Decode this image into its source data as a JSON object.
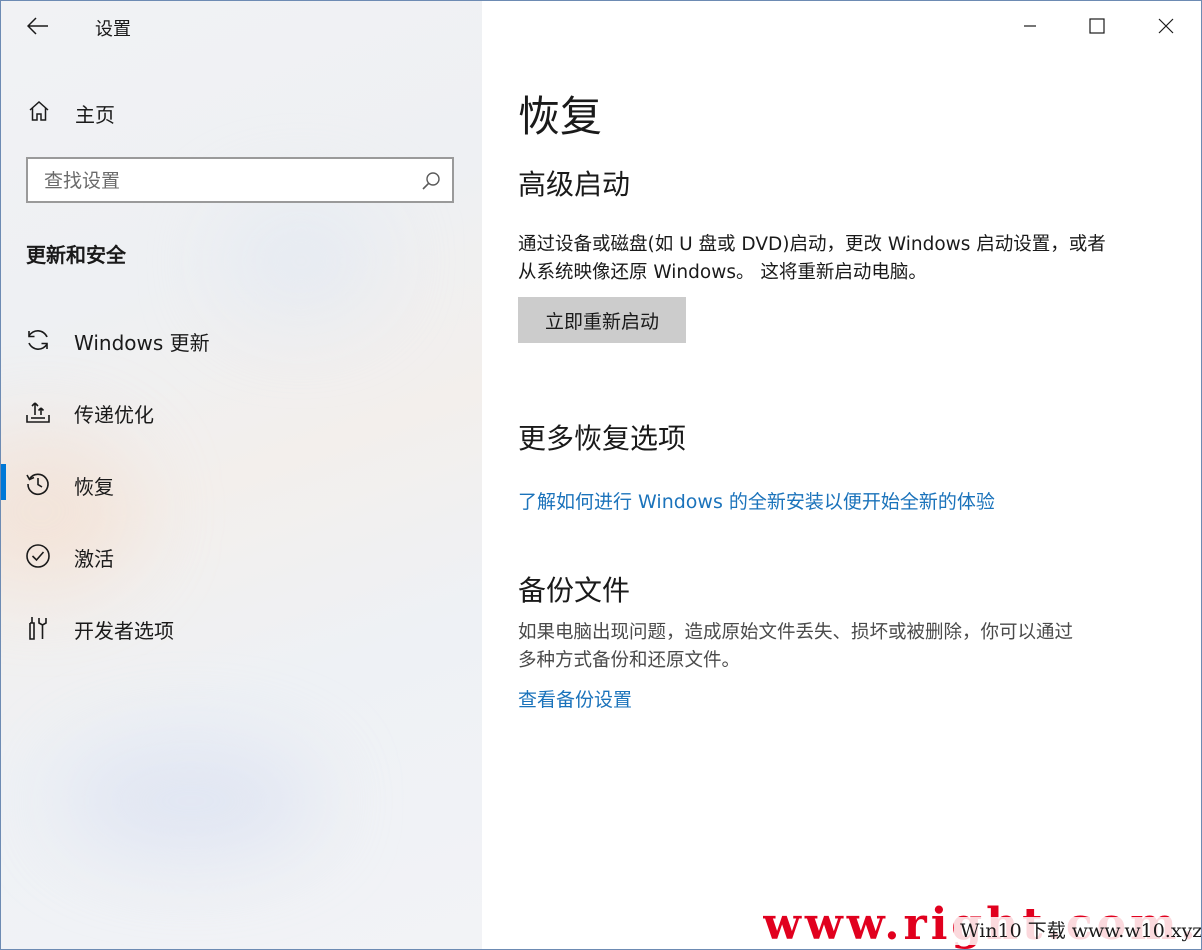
{
  "window": {
    "title": "设置"
  },
  "sidebar": {
    "home_label": "主页",
    "search_placeholder": "查找设置",
    "section_title": "更新和安全",
    "items": [
      {
        "label": "Windows 更新",
        "icon": "refresh-icon"
      },
      {
        "label": "传递优化",
        "icon": "delivery-optimization-icon"
      },
      {
        "label": "恢复",
        "icon": "history-icon",
        "selected": true
      },
      {
        "label": "激活",
        "icon": "check-circle-icon"
      },
      {
        "label": "开发者选项",
        "icon": "developer-tools-icon"
      }
    ]
  },
  "main": {
    "page_title": "恢复",
    "advanced_startup": {
      "heading": "高级启动",
      "desc_line1": "通过设备或磁盘(如 U 盘或 DVD)启动，更改 Windows 启动设置，或者",
      "desc_line2": "从系统映像还原 Windows。 这将重新启动电脑。",
      "button_label": "立即重新启动"
    },
    "more_options": {
      "heading": "更多恢复选项",
      "link": "了解如何进行 Windows 的全新安装以便开始全新的体验"
    },
    "backup": {
      "heading": "备份文件",
      "desc_line1": "如果电脑出现问题，造成原始文件丢失、损坏或被删除，你可以通过",
      "desc_line2": "多种方式备份和还原文件。",
      "link": "查看备份设置"
    }
  },
  "watermark": {
    "big_text": "www.right.com.cn",
    "small_text": "Win10 下载 www.w10.xyz"
  },
  "colors": {
    "accent": "#0078d7",
    "link": "#1b73bb",
    "button_bg": "#cccccc"
  }
}
